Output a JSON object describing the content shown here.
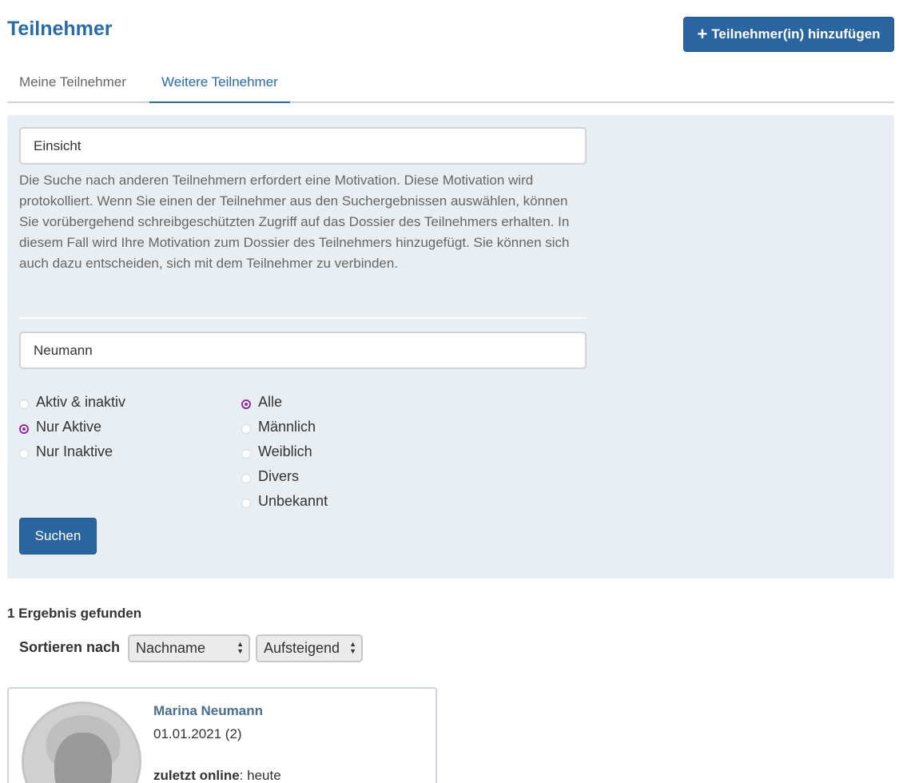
{
  "header": {
    "title": "Teilnehmer",
    "add_button_label": "Teilnehmer(in) hinzufügen",
    "add_button_icon": "plus-icon"
  },
  "tabs": [
    {
      "label": "Meine Teilnehmer",
      "active": false
    },
    {
      "label": "Weitere Teilnehmer",
      "active": true
    }
  ],
  "search": {
    "motivation_value": "Einsicht",
    "help_text": "Die Suche nach anderen Teilnehmern erfordert eine Motivation. Diese Motivation wird protokolliert. Wenn Sie einen der Teilnehmer aus den Suchergebnissen auswählen, können Sie vorübergehend schreibgeschützten Zugriff auf das Dossier des Teilnehmers erhalten. In diesem Fall wird Ihre Motivation zum Dossier des Teilnehmers hinzugefügt. Sie können sich auch dazu entscheiden, sich mit dem Teilnehmer zu verbinden.",
    "name_value": "Neumann",
    "status_options": [
      {
        "label": "Aktiv & inaktiv",
        "checked": false
      },
      {
        "label": "Nur Aktive",
        "checked": true
      },
      {
        "label": "Nur Inaktive",
        "checked": false
      }
    ],
    "gender_options": [
      {
        "label": "Alle",
        "checked": true
      },
      {
        "label": "Männlich",
        "checked": false
      },
      {
        "label": "Weiblich",
        "checked": false
      },
      {
        "label": "Divers",
        "checked": false
      },
      {
        "label": "Unbekannt",
        "checked": false
      }
    ],
    "search_button_label": "Suchen"
  },
  "results": {
    "count_text": "1 Ergebnis gefunden",
    "sort_label": "Sortieren nach",
    "sort_field": "Nachname",
    "sort_order": "Aufsteigend",
    "items": [
      {
        "name": "Marina Neumann",
        "date": "01.01.2021 (2)",
        "online_label": "zuletzt online",
        "online_value": ": heute"
      }
    ]
  },
  "colors": {
    "primary": "#2b65a0",
    "title": "#2a6aa8",
    "radio_accent": "#8e2aa8",
    "panel_bg": "#e9eef3"
  }
}
